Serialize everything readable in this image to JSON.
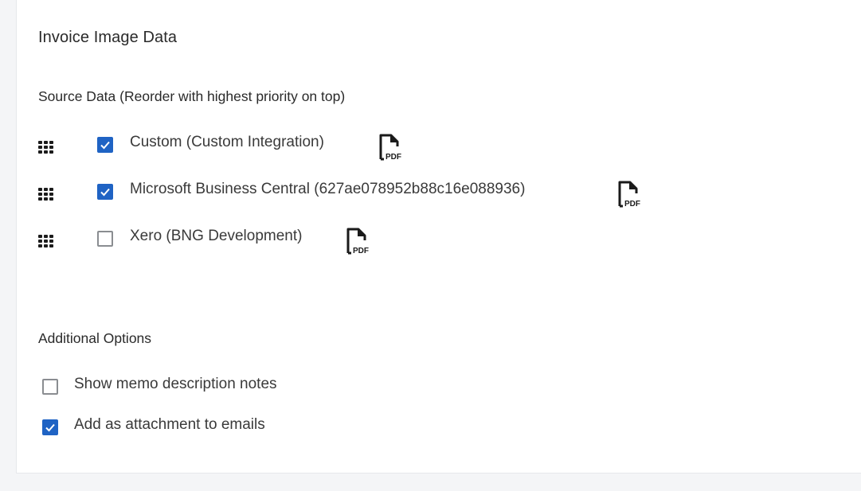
{
  "section": {
    "title": "Invoice Image Data"
  },
  "source_data": {
    "label": "Source Data (Reorder with highest priority on top)",
    "items": [
      {
        "label": "Custom (Custom Integration)",
        "checked": true,
        "icon": "pdf-icon"
      },
      {
        "label": "Microsoft Business Central (627ae078952b88c16e088936)",
        "checked": true,
        "icon": "pdf-icon"
      },
      {
        "label": "Xero (BNG Development)",
        "checked": false,
        "icon": "pdf-icon"
      }
    ]
  },
  "additional_options": {
    "label": "Additional Options",
    "items": [
      {
        "label": "Show memo description notes",
        "checked": false
      },
      {
        "label": "Add as attachment to emails",
        "checked": true
      }
    ]
  },
  "colors": {
    "accent": "#1f63c4",
    "checkbox_border": "#8a8d91",
    "text": "#2a2a2a"
  },
  "icons": {
    "drag": "drag-handle-icon",
    "check": "checkmark-icon",
    "file": "pdf-file-icon",
    "file_text": "PDF"
  }
}
